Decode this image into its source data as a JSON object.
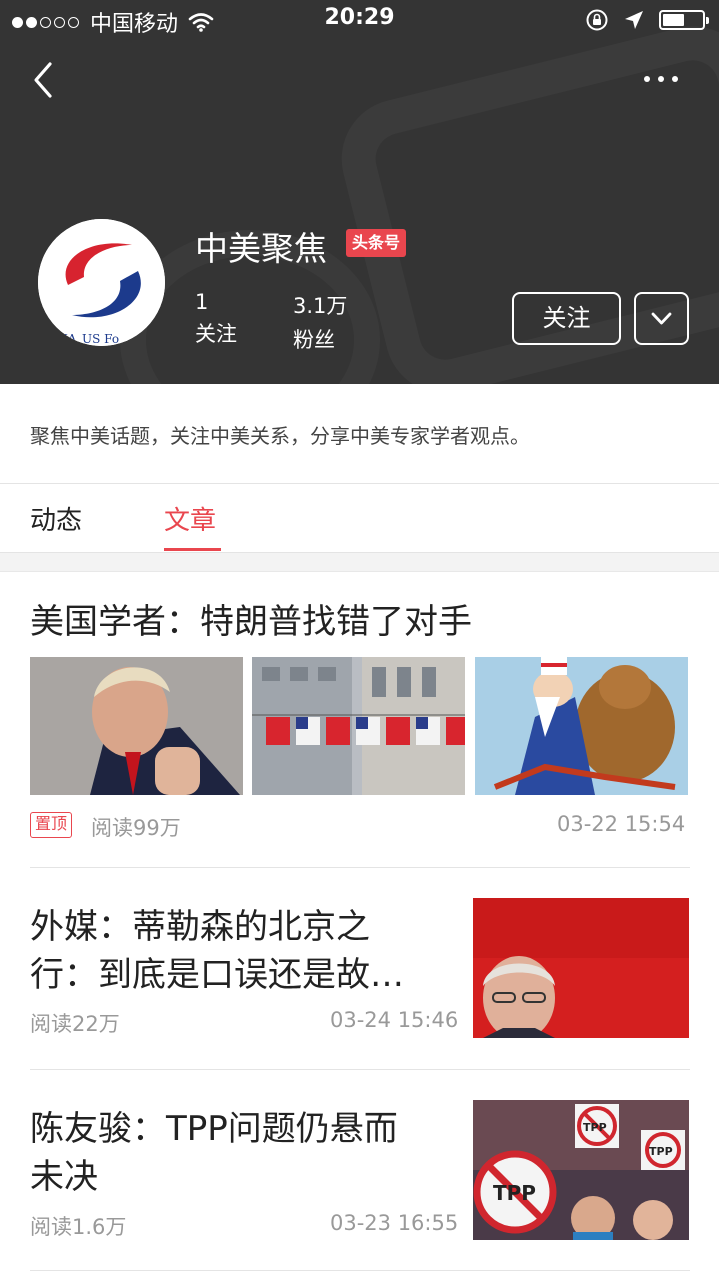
{
  "status_bar": {
    "carrier": "中国移动",
    "time": "20:29"
  },
  "profile": {
    "name": "中美聚焦",
    "badge": "头条号",
    "following_count": "1",
    "following_label": "关注",
    "fans_count": "3.1万",
    "fans_label": "粉丝",
    "follow_button": "关注",
    "description": "聚焦中美话题，关注中美关系，分享中美专家学者观点。"
  },
  "tabs": [
    {
      "label": "动态",
      "active": false
    },
    {
      "label": "文章",
      "active": true
    }
  ],
  "articles": [
    {
      "title": "美国学者：特朗普找错了对手",
      "pinned_label": "置顶",
      "reads": "阅读99万",
      "date": "03-22 15:54"
    },
    {
      "title_line1": "外媒：蒂勒森的北京之",
      "title_line2": "行：到底是口误还是故…",
      "reads": "阅读22万",
      "date": "03-24 15:46"
    },
    {
      "title_line1": "陈友骏：TPP问题仍悬而",
      "title_line2": "未决",
      "reads": "阅读1.6万",
      "date": "03-23 16:55"
    }
  ],
  "colors": {
    "header_bg": "#343434",
    "accent": "#e9464e"
  }
}
